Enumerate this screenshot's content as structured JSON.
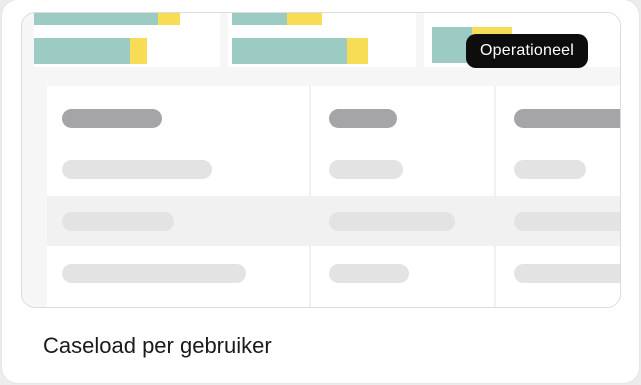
{
  "card": {
    "title": "Caseload per gebruiker",
    "badge": "Operationeel"
  },
  "colors": {
    "bar_primary": "#9ccbc4",
    "bar_accent": "#f7dc55",
    "badge_background": "#0d0d0d",
    "skeleton_header": "#a5a5a7",
    "skeleton_row": "#e3e3e3"
  }
}
